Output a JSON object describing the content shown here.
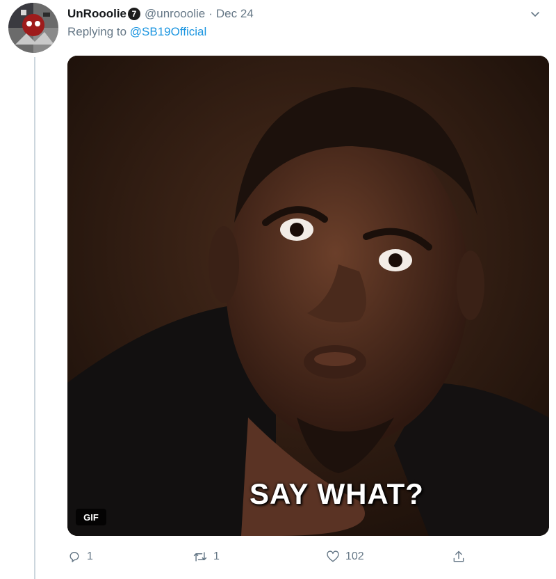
{
  "tweet": {
    "display_name": "UnRooolie",
    "badge": "7",
    "handle": "@unrooolie",
    "separator": "·",
    "date": "Dec 24",
    "replying_prefix": "Replying to ",
    "replying_to": "@SB19Official",
    "media": {
      "caption": "SAY WHAT?",
      "badge": "GIF"
    },
    "actions": {
      "reply_count": "1",
      "retweet_count": "1",
      "like_count": "102"
    }
  },
  "icons": {
    "more": "chevron-down-icon",
    "reply": "reply-icon",
    "retweet": "retweet-icon",
    "like": "heart-icon",
    "share": "share-icon"
  },
  "colors": {
    "link": "#1b95e0",
    "secondary_text": "#657786",
    "thread_line": "#ccd6dd"
  }
}
